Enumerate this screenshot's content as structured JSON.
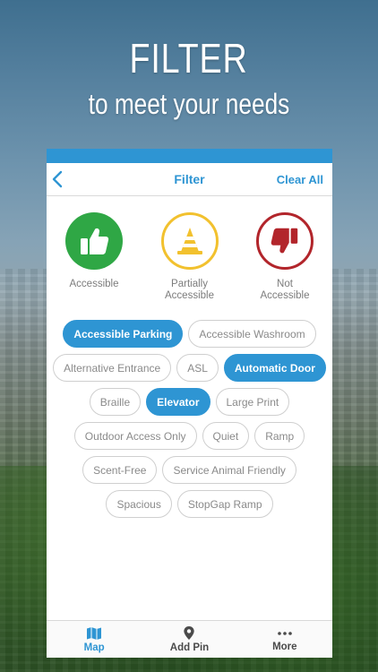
{
  "promo": {
    "headline": "FILTER",
    "subheadline": "to meet your needs"
  },
  "colors": {
    "accent": "#2e95d3",
    "accessible": "#2fa745",
    "partial": "#f2c12e",
    "not_accessible": "#b2252b"
  },
  "navbar": {
    "title": "Filter",
    "clear_label": "Clear All",
    "back_icon": "chevron-left-icon"
  },
  "accessibility": [
    {
      "label": "Accessible",
      "icon": "thumbs-up-icon"
    },
    {
      "label": "Partially\nAccessible",
      "icon": "traffic-cone-icon"
    },
    {
      "label": "Not\nAccessible",
      "icon": "thumbs-down-icon"
    }
  ],
  "tags": [
    {
      "label": "Accessible Parking",
      "selected": true
    },
    {
      "label": "Accessible Washroom",
      "selected": false
    },
    {
      "label": "Alternative Entrance",
      "selected": false
    },
    {
      "label": "ASL",
      "selected": false
    },
    {
      "label": "Automatic Door",
      "selected": true
    },
    {
      "label": "Braille",
      "selected": false
    },
    {
      "label": "Elevator",
      "selected": true
    },
    {
      "label": "Large Print",
      "selected": false
    },
    {
      "label": "Outdoor Access Only",
      "selected": false
    },
    {
      "label": "Quiet",
      "selected": false
    },
    {
      "label": "Ramp",
      "selected": false
    },
    {
      "label": "Scent-Free",
      "selected": false
    },
    {
      "label": "Service Animal Friendly",
      "selected": false
    },
    {
      "label": "Spacious",
      "selected": false
    },
    {
      "label": "StopGap Ramp",
      "selected": false
    }
  ],
  "tabbar": [
    {
      "label": "Map",
      "icon": "map-icon",
      "active": true
    },
    {
      "label": "Add Pin",
      "icon": "location-pin-icon",
      "active": false
    },
    {
      "label": "More",
      "icon": "more-dots-icon",
      "active": false
    }
  ]
}
